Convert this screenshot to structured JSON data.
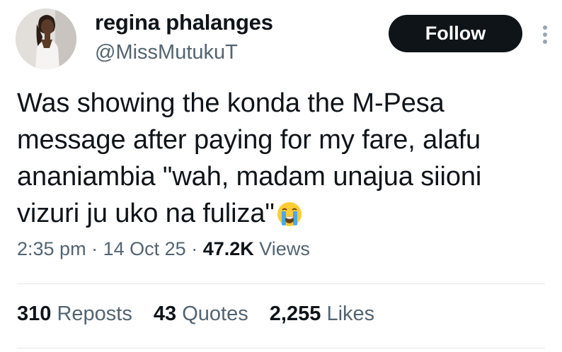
{
  "author": {
    "display_name": "regina phalanges",
    "handle": "@MissMutukuT"
  },
  "follow_button": {
    "label": "Follow"
  },
  "tweet": {
    "lines": [
      "Was showing the konda the M-Pesa",
      "message after paying for my fare, alafu",
      "ananiambia \"wah, madam unajua siioni",
      "vizuri ju uko na fuliza\""
    ],
    "emoji": "loudly-crying-face"
  },
  "meta": {
    "time": "2:35 pm",
    "separator": "·",
    "date": "14 Oct 25",
    "views_count": "47.2K",
    "views_label": "Views"
  },
  "stats": {
    "reposts_count": "310",
    "reposts_label": "Reposts",
    "quotes_count": "43",
    "quotes_label": "Quotes",
    "likes_count": "2,255",
    "likes_label": "Likes"
  },
  "colors": {
    "text": "#0f1419",
    "secondary": "#536471",
    "button_bg": "#0f1419",
    "divider": "#e4e8eb"
  }
}
